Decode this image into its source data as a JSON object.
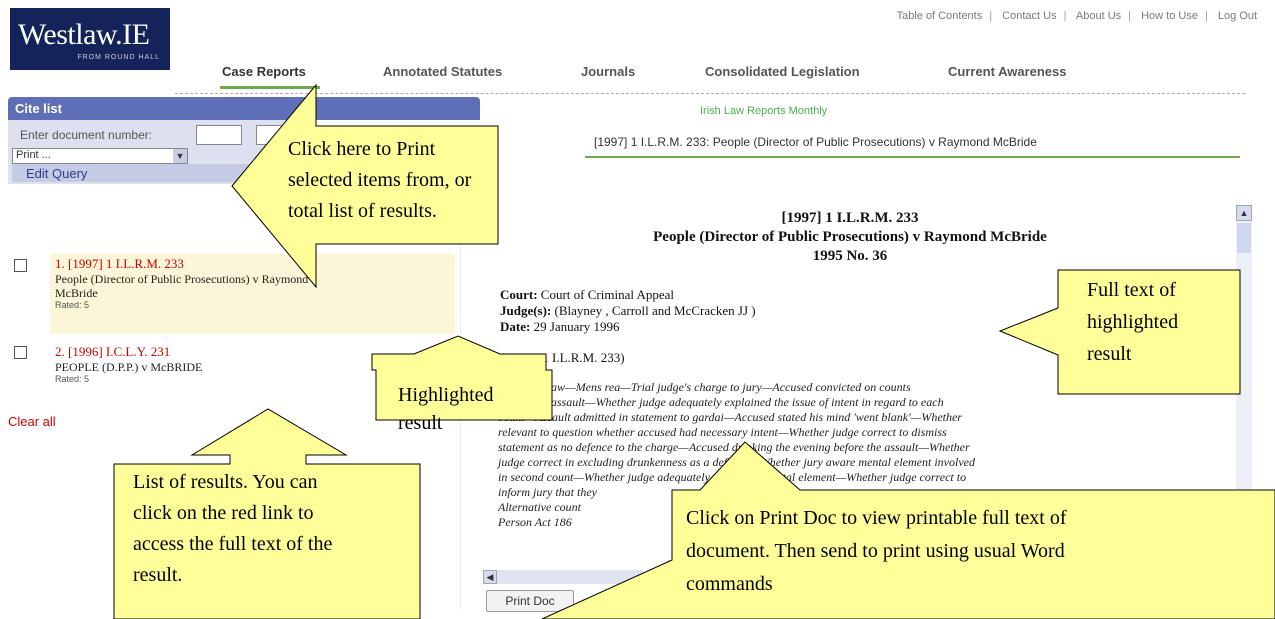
{
  "logo": {
    "main": "Westlaw.IE",
    "sub": "FROM ROUND HALL"
  },
  "top_links": [
    "Table of Contents",
    "Contact Us",
    "About Us",
    "How to Use",
    "Log Out"
  ],
  "nav_tabs": [
    "Case Reports",
    "Annotated Statutes",
    "Journals",
    "Consolidated Legislation",
    "Current Awareness"
  ],
  "cite_list": {
    "title": "Cite list",
    "enter_label": "Enter document number:",
    "print_option": "Print ...",
    "edit_query": "Edit Query"
  },
  "results": [
    {
      "cite": "1. [1997] 1 I.L.R.M. 233",
      "title_line1": "People (Director of Public Prosecutions) v Raymond",
      "title_line2": "McBride",
      "rated": "Rated: 5"
    },
    {
      "cite": "2. [1996] I.C.L.Y. 231",
      "title_line1": "PEOPLE (D.P.P.) v McBRIDE",
      "title_line2": "",
      "rated": "Rated: 5"
    }
  ],
  "clear_all": "Clear all",
  "document": {
    "series": "Irish Law Reports Monthly",
    "heading": "[1997] 1 I.L.R.M. 233: People (Director of Public Prosecutions) v Raymond McBride",
    "title1": "[1997] 1 I.L.R.M. 233",
    "title2": "People (Director of Public Prosecutions) v Raymond McBride",
    "title3": "1995 No. 36",
    "court_label": "Court:",
    "court": "Court of Criminal Appeal",
    "judges_label": "Judge(s):",
    "judges": "(Blayney , Carroll and McCracken JJ )",
    "date_label": "Date:",
    "date": "29 January 1996",
    "citation": "([1997] 1 I.L.R.M. 233)",
    "body_lines": [
      "Criminal Law—Mens rea—Trial judge's charge to jury—Accused convicted on counts",
      "relating to assault—Whether judge adequately explained the issue of intent in regard to each",
      "count—Assault admitted in statement to gardai—Accused stated his mind 'went blank'—Whether",
      "relevant to question whether accused had necessary intent—Whether judge correct to dismiss",
      "statement as no defence to the charge—Accused drinking the evening before the assault—Whether",
      "judge correct in excluding drunkenness as a defence—Whether jury aware mental element involved",
      "in second count—Whether judge adequately explained mental element—Whether judge correct to",
      "inform jury that they                                                                   ",
      "Alternative count",
      "Person Act 186"
    ],
    "print_doc": "Print Doc"
  },
  "callouts": {
    "print": [
      "Click here to Print",
      "selected items from, or",
      "total list of results."
    ],
    "highlighted": [
      "Highlighted",
      "result"
    ],
    "full_text": [
      "Full text of",
      "highlighted",
      "result"
    ],
    "list": [
      "List of results.  You can",
      "click on the red link to",
      "access the full text of the",
      "result."
    ],
    "print_doc": [
      "Click on Print Doc to view printable full text of",
      "document. Then send to print using usual Word",
      "commands"
    ]
  },
  "colors": {
    "accent_blue": "#5f6fb7",
    "nav_green": "#6ea94b",
    "link_red": "#cc0000",
    "callout_fill": "#ffff99"
  }
}
